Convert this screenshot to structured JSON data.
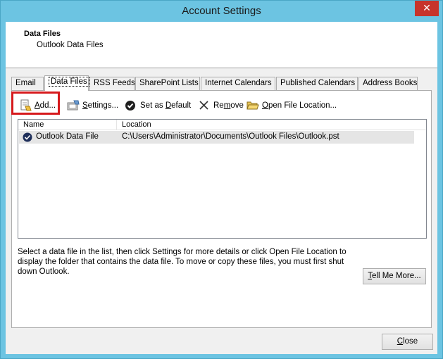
{
  "window": {
    "title": "Account Settings",
    "close_glyph": "✕"
  },
  "header": {
    "title": "Data Files",
    "subtitle": "Outlook Data Files"
  },
  "tabs": [
    {
      "label": "Email"
    },
    {
      "label": "Data Files"
    },
    {
      "label": "RSS Feeds"
    },
    {
      "label": "SharePoint Lists"
    },
    {
      "label": "Internet Calendars"
    },
    {
      "label": "Published Calendars"
    },
    {
      "label": "Address Books"
    }
  ],
  "toolbar": {
    "add": {
      "mnemonic": "A",
      "rest": "dd..."
    },
    "settings": {
      "mnemonic": "S",
      "rest": "ettings..."
    },
    "set_default": {
      "pre": "Set as ",
      "mnemonic": "D",
      "post": "efault"
    },
    "remove": {
      "pre": "Re",
      "mnemonic": "m",
      "post": "ove"
    },
    "open_location": {
      "mnemonic": "O",
      "rest": "pen File Location..."
    }
  },
  "list": {
    "columns": [
      "Name",
      "Location"
    ],
    "rows": [
      {
        "name": "Outlook Data File",
        "location": "C:\\Users\\Administrator\\Documents\\Outlook Files\\Outlook.pst"
      }
    ]
  },
  "description": "Select a data file in the list, then click Settings for more details or click Open File Location to display the folder that contains the data file. To move or copy these files, you must first shut down Outlook.",
  "tell_me_more": {
    "mnemonic": "T",
    "rest": "ell Me More..."
  },
  "close_button": {
    "mnemonic": "C",
    "rest": "lose"
  },
  "colors": {
    "title_bar": "#6cc4e2",
    "close_red": "#c7342b",
    "highlight_red": "#d6191c"
  }
}
